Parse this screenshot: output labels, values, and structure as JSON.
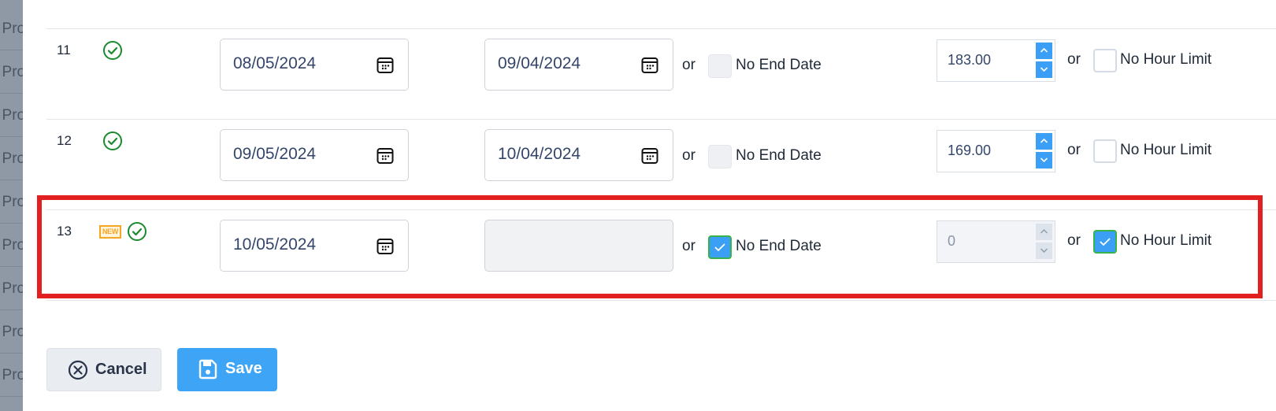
{
  "backdrop": {
    "rows": [
      "; Pro",
      "; Pro",
      "; Pro",
      "; Pro",
      "; Pro",
      "; Pro",
      "; Pro",
      "; Pro",
      "; Pro"
    ]
  },
  "rows": [
    {
      "number": "11",
      "is_new": false,
      "new_badge": "",
      "status_icon": "check-circle-icon",
      "start_date": "08/05/2024",
      "end_date": "09/04/2024",
      "end_date_disabled": false,
      "or_label": "or",
      "no_end_date_label": "No End Date",
      "no_end_date_checked": false,
      "hours": "183.00",
      "hours_disabled": false,
      "no_hour_limit_label": "No Hour Limit",
      "no_hour_limit_checked": false
    },
    {
      "number": "12",
      "is_new": false,
      "new_badge": "",
      "status_icon": "check-circle-icon",
      "start_date": "09/05/2024",
      "end_date": "10/04/2024",
      "end_date_disabled": false,
      "or_label": "or",
      "no_end_date_label": "No End Date",
      "no_end_date_checked": false,
      "hours": "169.00",
      "hours_disabled": false,
      "no_hour_limit_label": "No Hour Limit",
      "no_hour_limit_checked": false
    },
    {
      "number": "13",
      "is_new": true,
      "new_badge": "NEW",
      "status_icon": "check-circle-icon",
      "start_date": "10/05/2024",
      "end_date": "",
      "end_date_disabled": true,
      "or_label": "or",
      "no_end_date_label": "No End Date",
      "no_end_date_checked": true,
      "hours": "0",
      "hours_disabled": true,
      "no_hour_limit_label": "No Hour Limit",
      "no_hour_limit_checked": true
    }
  ],
  "actions": {
    "cancel_label": "Cancel",
    "save_label": "Save"
  },
  "colors": {
    "accent": "#3ea5f6",
    "success": "#1a8a2e",
    "new_badge": "#f5a623",
    "highlight": "#e32020"
  }
}
